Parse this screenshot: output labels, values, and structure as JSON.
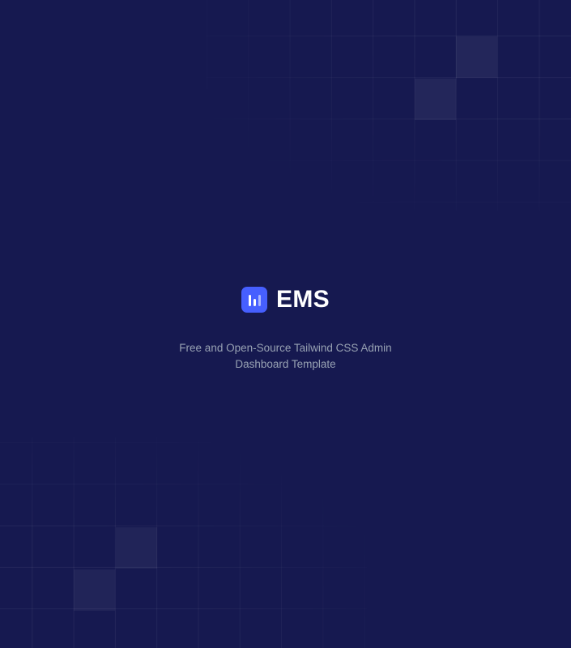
{
  "brand": {
    "name": "EMS",
    "logo_icon": "bar-chart-icon",
    "accent_color": "#465fff"
  },
  "tagline": {
    "line1": "Free and Open-Source Tailwind CSS Admin",
    "line2": "Dashboard Template"
  },
  "colors": {
    "background": "#161950",
    "tagline_text": "#98a2b3"
  }
}
